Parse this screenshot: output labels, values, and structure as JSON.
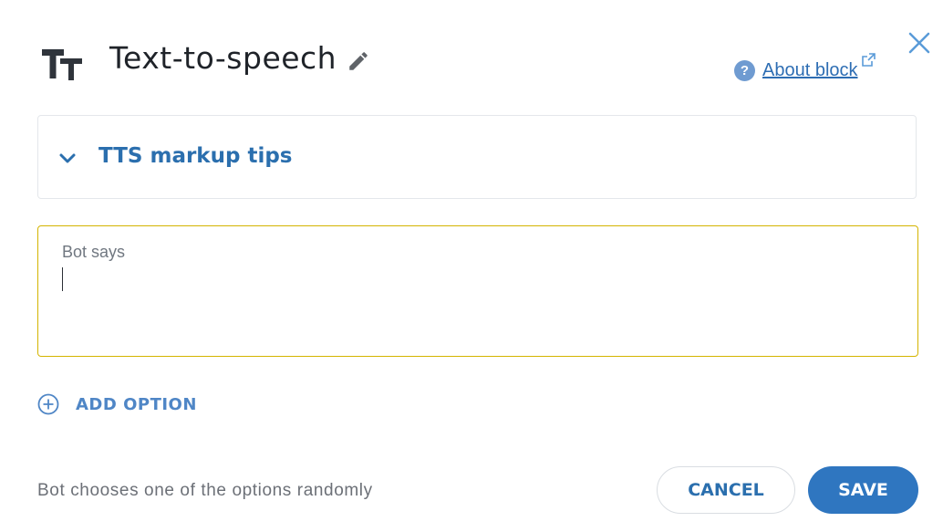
{
  "header": {
    "icon": "text-size-icon",
    "title": "Text-to-speech",
    "about_label": "About block"
  },
  "tips": {
    "label": "TTS markup tips",
    "expanded": false
  },
  "bot_says": {
    "label": "Bot says",
    "value": ""
  },
  "add_option": {
    "label": "ADD OPTION"
  },
  "footer": {
    "note": "Bot chooses one of the options randomly",
    "cancel_label": "CANCEL",
    "save_label": "SAVE"
  },
  "colors": {
    "accent": "#2f76c0",
    "link": "#2d6db3",
    "field_border_active": "#d4b400"
  }
}
